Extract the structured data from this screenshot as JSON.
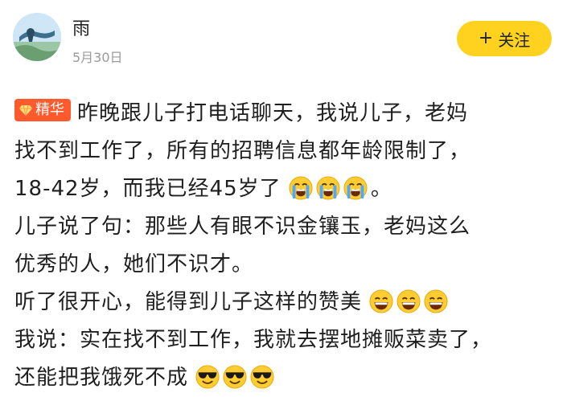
{
  "post": {
    "username": "雨",
    "date": "5月30日",
    "follow_label": "关注",
    "badge_label": "精华",
    "lines": [
      "昨晚跟儿子打电话聊天，我说儿子，老妈",
      "找不到工作了，所有的招聘信息都年龄限制了，",
      "18-42岁，而我已经45岁了",
      "。",
      "儿子说了句：那些人有眼不识金镶玉，老妈这么",
      "优秀的人，她们不识才。",
      "听了很开心，能得到儿子这样的赞美",
      "我说：实在找不到工作，我就去摆地摊贩菜卖了，",
      "还能把我饿死不成"
    ],
    "emoji": {
      "crying": "loudly-crying-face-icon",
      "grinning": "grinning-face-icon",
      "sunglasses": "smiling-face-with-sunglasses-icon"
    }
  },
  "colors": {
    "follow_bg": "#ffd21f",
    "badge_bg": "#ff5a2d",
    "date": "#9a9a9a"
  }
}
